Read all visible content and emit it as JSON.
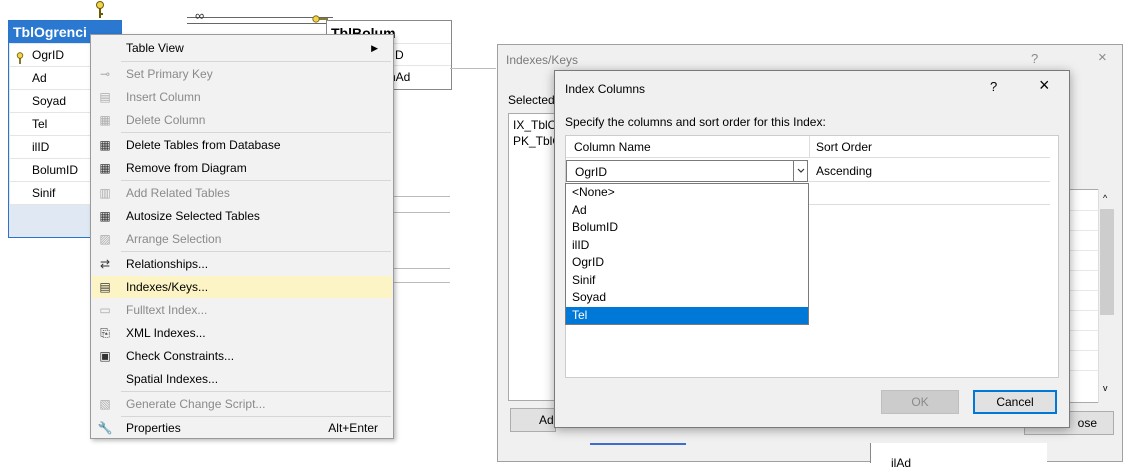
{
  "diagram": {
    "table1": {
      "title": "TblOgrenci",
      "columns": [
        "OgrID",
        "Ad",
        "Soyad",
        "Tel",
        "ilID",
        "BolumID",
        "Sinif"
      ]
    },
    "table2": {
      "title": "TblBolum",
      "rows": [
        "lID",
        "nAd"
      ]
    }
  },
  "context_menu": {
    "items": [
      {
        "label": "Table View",
        "icon": "table-view-icon",
        "enabled": true,
        "submenu": true
      },
      {
        "label": "Set Primary Key",
        "icon": "key-icon",
        "enabled": false
      },
      {
        "label": "Insert Column",
        "icon": "insert-column-icon",
        "enabled": false
      },
      {
        "label": "Delete Column",
        "icon": "delete-column-icon",
        "enabled": false
      },
      {
        "label": "Delete Tables from Database",
        "icon": "delete-table-icon",
        "enabled": true
      },
      {
        "label": "Remove from Diagram",
        "icon": "remove-table-icon",
        "enabled": true
      },
      {
        "label": "Add Related Tables",
        "icon": "related-tables-icon",
        "enabled": false
      },
      {
        "label": "Autosize Selected Tables",
        "icon": "autosize-icon",
        "enabled": true
      },
      {
        "label": "Arrange Selection",
        "icon": "arrange-icon",
        "enabled": false
      },
      {
        "label": "Relationships...",
        "icon": "relationships-icon",
        "enabled": true
      },
      {
        "label": "Indexes/Keys...",
        "icon": "indexes-icon",
        "enabled": true,
        "highlighted": true
      },
      {
        "label": "Fulltext Index...",
        "icon": "fulltext-icon",
        "enabled": false
      },
      {
        "label": "XML Indexes...",
        "icon": "xml-icon",
        "enabled": true
      },
      {
        "label": "Check Constraints...",
        "icon": "check-constraint-icon",
        "enabled": true
      },
      {
        "label": "Spatial Indexes...",
        "icon": "",
        "enabled": true
      },
      {
        "label": "Generate Change Script...",
        "icon": "script-icon",
        "enabled": false
      },
      {
        "label": "Properties",
        "icon": "wrench-icon",
        "enabled": true,
        "shortcut": "Alt+Enter"
      }
    ]
  },
  "indexes_dialog": {
    "title": "Indexes/Keys",
    "help": "?",
    "close": "×",
    "selected_label": "Selected",
    "list_items": [
      "IX_TblO",
      "PK_TblO"
    ],
    "add_label": "Ad",
    "close_button_label": "ose",
    "grid_item": "ilAd"
  },
  "index_columns_dialog": {
    "title": "Index Columns",
    "help": "?",
    "close": "×",
    "description": "Specify the columns and sort order for this Index:",
    "header_column_name": "Column Name",
    "header_sort_order": "Sort Order",
    "selected_column": "OgrID",
    "sort_order": "Ascending",
    "dropdown_options": [
      "<None>",
      "Ad",
      "BolumID",
      "ilID",
      "OgrID",
      "Sinif",
      "Soyad",
      "Tel"
    ],
    "dropdown_selected": "Tel",
    "ok_label": "OK",
    "cancel_label": "Cancel"
  }
}
